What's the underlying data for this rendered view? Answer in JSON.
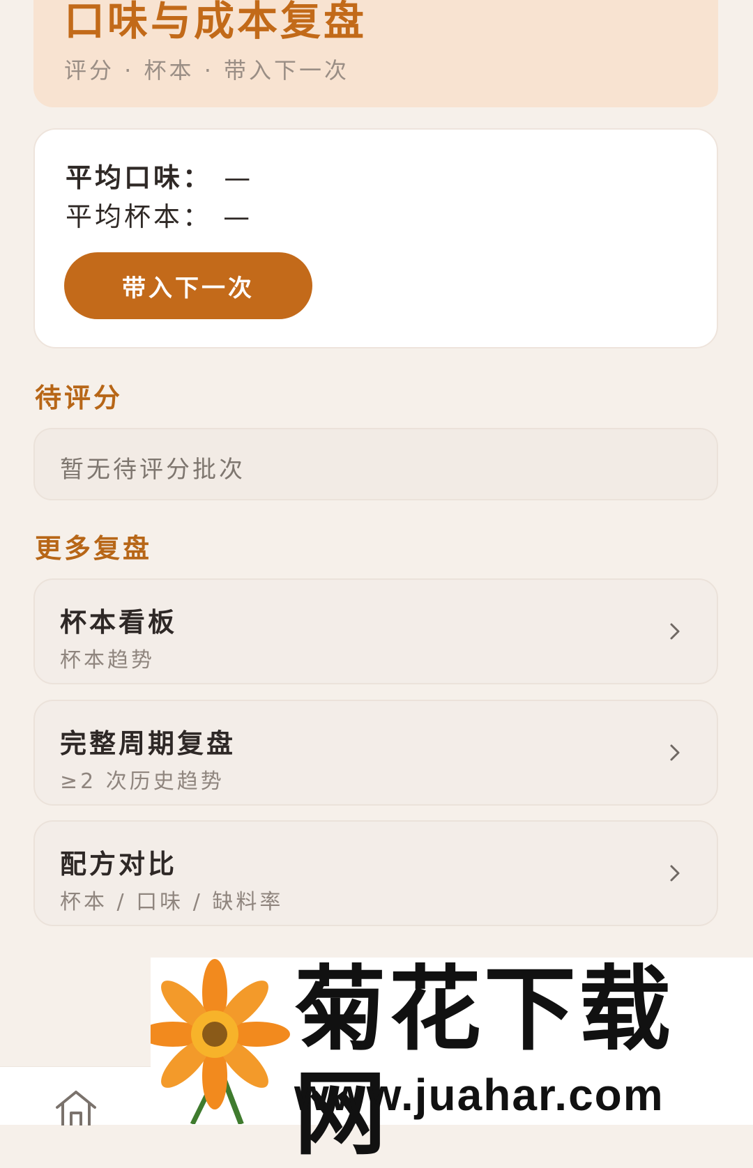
{
  "header": {
    "title": "口味与成本复盘",
    "subtitle": "评分 · 杯本 · 带入下一次"
  },
  "summary": {
    "avg_taste_label": "平均口味：",
    "avg_taste_value": "—",
    "avg_cost_label": "平均杯本：",
    "avg_cost_value": "—",
    "carry_button": "带入下一次"
  },
  "pending": {
    "title": "待评分",
    "empty_text": "暂无待评分批次"
  },
  "more": {
    "title": "更多复盘",
    "items": [
      {
        "title": "杯本看板",
        "subtitle": "杯本趋势"
      },
      {
        "title": "完整周期复盘",
        "subtitle": "≥2 次历史趋势"
      },
      {
        "title": "配方对比",
        "subtitle": "杯本 / 口味 / 缺料率"
      }
    ]
  },
  "bottom_nav": {
    "home_icon": "home-icon"
  },
  "watermark": {
    "title": "菊花下载网",
    "url": "www.juahar.com"
  },
  "colors": {
    "accent": "#c36a1a",
    "header_bg": "#f8e3d1",
    "page_bg": "#f6f0ea"
  }
}
